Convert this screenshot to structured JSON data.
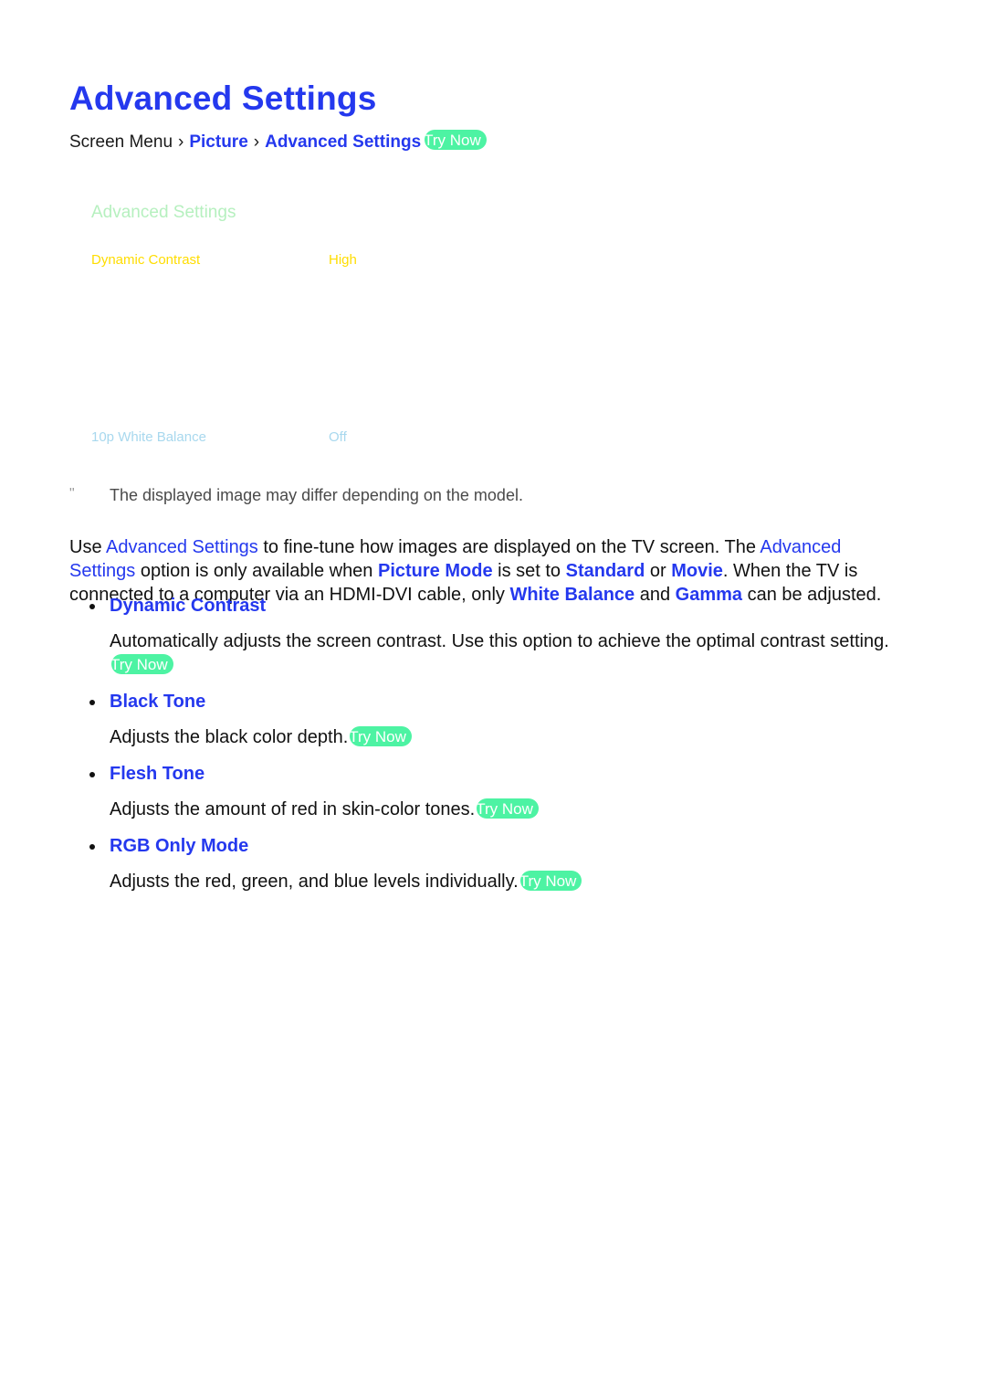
{
  "page": {
    "title": "Advanced Settings",
    "background": "#ffffff",
    "accent_blue": "#2438ee",
    "badge_green": "#4df3a3"
  },
  "breadcrumb": {
    "root": "Screen Menu",
    "separator": "›",
    "items": [
      {
        "label": "Picture"
      },
      {
        "label": "Advanced Settings"
      }
    ],
    "try_now_label": "Try Now"
  },
  "tv_menu_mock": {
    "menu_title": "Advanced Settings",
    "menu_title_color": "#b6f0bf",
    "selected_color": "#ffdd00",
    "dim_color": "#a8d8ee",
    "rows": [
      {
        "label": "Dynamic Contrast",
        "value": "High",
        "state": "selected"
      },
      {
        "label": "",
        "value": "",
        "state": "hidden"
      },
      {
        "label": "",
        "value": "",
        "state": "hidden"
      },
      {
        "label": "",
        "value": "",
        "state": "hidden"
      },
      {
        "label": "",
        "value": "",
        "state": "hidden"
      },
      {
        "label": "10p White Balance",
        "value": "Off",
        "state": "dim"
      }
    ]
  },
  "note": {
    "mark": "\"",
    "text": "The displayed image may differ depending on the model."
  },
  "intro": {
    "segments": [
      {
        "text": "Use ",
        "style": "plain"
      },
      {
        "text": "Advanced Settings",
        "style": "link"
      },
      {
        "text": " to fine-tune how images are displayed on the TV screen. The ",
        "style": "plain"
      },
      {
        "text": "Advanced Settings",
        "style": "link"
      },
      {
        "text": " option is only available when ",
        "style": "plain"
      },
      {
        "text": "Picture Mode",
        "style": "bold-link"
      },
      {
        "text": " is set to ",
        "style": "plain"
      },
      {
        "text": "Standard",
        "style": "bold-link"
      },
      {
        "text": " or ",
        "style": "plain"
      },
      {
        "text": "Movie",
        "style": "bold-link"
      },
      {
        "text": ". When the TV is connected to a computer via an HDMI-DVI cable, only ",
        "style": "plain"
      },
      {
        "text": "White Balance",
        "style": "bold-link"
      },
      {
        "text": " and ",
        "style": "plain"
      },
      {
        "text": "Gamma",
        "style": "bold-link"
      },
      {
        "text": " can be adjusted.",
        "style": "plain"
      }
    ]
  },
  "options": [
    {
      "heading": "Dynamic Contrast",
      "description": "Automatically adjusts the screen contrast. Use this option to achieve the optimal contrast setting.",
      "try_now_label": "Try Now"
    },
    {
      "heading": "Black Tone",
      "description": "Adjusts the black color depth.",
      "try_now_label": "Try Now"
    },
    {
      "heading": "Flesh Tone",
      "description": "Adjusts the amount of red in skin-color tones.",
      "try_now_label": "Try Now"
    },
    {
      "heading": "RGB Only Mode",
      "description": "Adjusts the red, green, and blue levels individually.",
      "try_now_label": "Try Now"
    }
  ]
}
